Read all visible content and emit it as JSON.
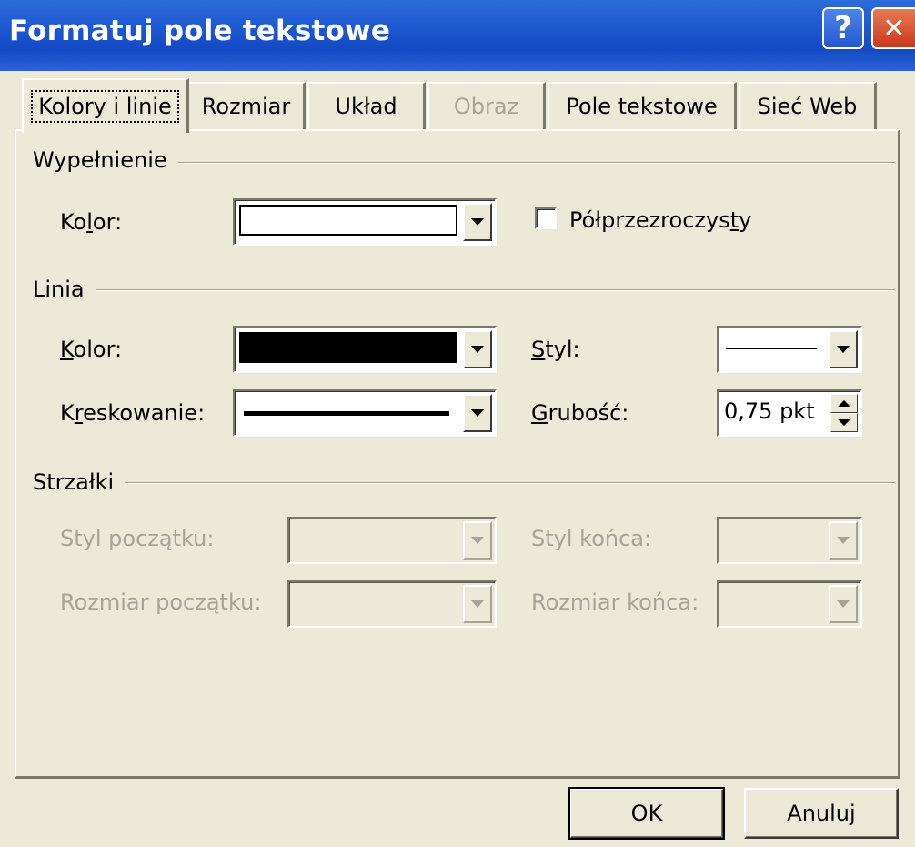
{
  "window": {
    "title": "Formatuj pole tekstowe",
    "help_glyph": "?",
    "close_glyph": "✕"
  },
  "tabs": [
    {
      "label": "Kolory i linie",
      "state": "active"
    },
    {
      "label": "Rozmiar",
      "state": "normal"
    },
    {
      "label": "Układ",
      "state": "normal"
    },
    {
      "label": "Obraz",
      "state": "disabled"
    },
    {
      "label": "Pole tekstowe",
      "state": "normal"
    },
    {
      "label": "Sieć Web",
      "state": "normal"
    }
  ],
  "fill": {
    "section_label": "Wypełnienie",
    "color_label": "Kolor:",
    "color_value": "#FFFFFF",
    "semi_transparent_label": "Półprzezroczysty",
    "semi_transparent_checked": false
  },
  "line": {
    "section_label": "Linia",
    "color_label": "Kolor:",
    "color_value": "#000000",
    "dash_label": "Kreskowanie:",
    "style_label": "Styl:",
    "weight_label": "Grubość:",
    "weight_value": "0,75 pkt"
  },
  "arrows": {
    "section_label": "Strzałki",
    "begin_style_label": "Styl początku:",
    "end_style_label": "Styl końca:",
    "begin_size_label": "Rozmiar początku:",
    "end_size_label": "Rozmiar końca:",
    "enabled": false
  },
  "buttons": {
    "ok": "OK",
    "cancel": "Anuluj"
  }
}
